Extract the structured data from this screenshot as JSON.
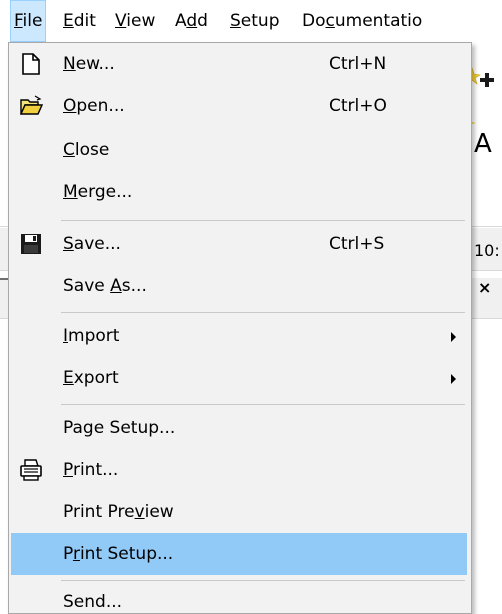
{
  "menubar": {
    "items": [
      {
        "mnemonic": "F",
        "rest": "ile"
      },
      {
        "mnemonic": "E",
        "rest": "dit"
      },
      {
        "mnemonic": "V",
        "rest": "iew"
      },
      {
        "pre": "A",
        "mnemonic": "d",
        "rest": "d"
      },
      {
        "mnemonic": "S",
        "rest": "etup"
      },
      {
        "pre": "Do",
        "mnemonic": "c",
        "rest": "umentatio"
      }
    ]
  },
  "background": {
    "letter_a": "A",
    "partial_text": "10:",
    "partial_x": "×"
  },
  "file_menu": {
    "items": [
      {
        "pre": "",
        "mnemonic": "N",
        "rest": "ew...",
        "shortcut": "Ctrl+N",
        "icon": "new-document-icon"
      },
      {
        "pre": "",
        "mnemonic": "O",
        "rest": "pen...",
        "shortcut": "Ctrl+O",
        "icon": "open-folder-icon"
      },
      {
        "pre": "",
        "mnemonic": "C",
        "rest": "lose",
        "shortcut": ""
      },
      {
        "pre": "",
        "mnemonic": "M",
        "rest": "erge...",
        "shortcut": ""
      },
      {
        "pre": "",
        "mnemonic": "S",
        "rest": "ave...",
        "shortcut": "Ctrl+S",
        "icon": "floppy-disk-icon"
      },
      {
        "pre": "Save ",
        "mnemonic": "A",
        "rest": "s...",
        "shortcut": ""
      },
      {
        "pre": "",
        "mnemonic": "I",
        "rest": "mport",
        "shortcut": "",
        "submenu": true
      },
      {
        "pre": "",
        "mnemonic": "E",
        "rest": "xport",
        "shortcut": "",
        "submenu": true
      },
      {
        "pre": "Page Setup...",
        "mnemonic": "",
        "rest": "",
        "shortcut": ""
      },
      {
        "pre": "",
        "mnemonic": "P",
        "rest": "rint...",
        "shortcut": "",
        "icon": "printer-icon"
      },
      {
        "pre": "Print Pre",
        "mnemonic": "v",
        "rest": "iew",
        "shortcut": ""
      },
      {
        "pre": "P",
        "mnemonic": "r",
        "rest": "int Setup...",
        "shortcut": "",
        "highlighted": true
      },
      {
        "pre": "Send...",
        "mnemonic": "",
        "rest": "",
        "shortcut": ""
      }
    ]
  },
  "colors": {
    "menu_bg": "#f2f2f2",
    "highlight": "#91c9f7",
    "active_menubar": "#cce8ff"
  }
}
